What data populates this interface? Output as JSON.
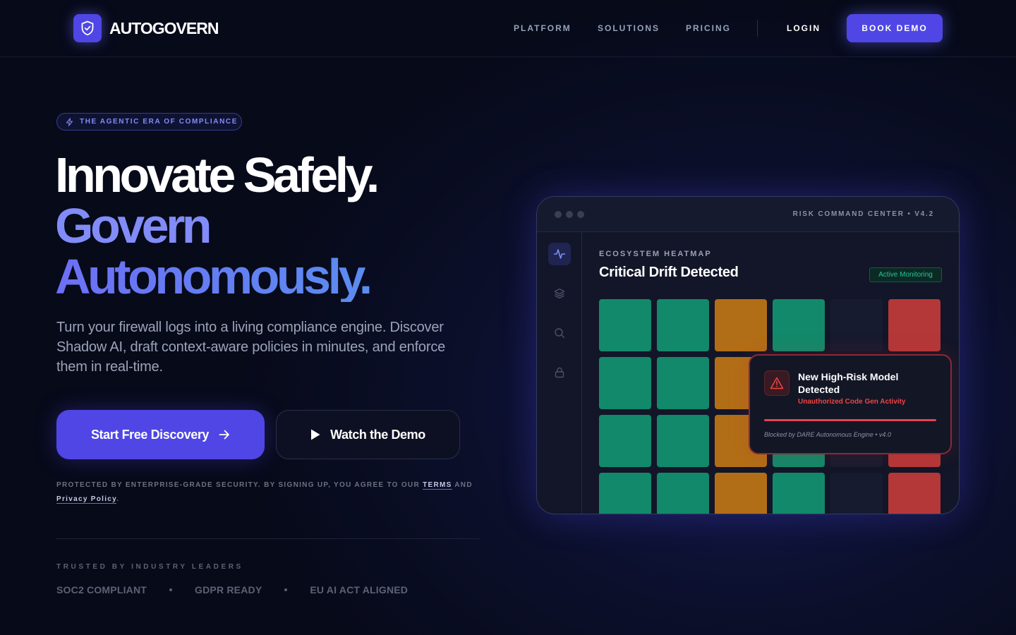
{
  "brand": {
    "name": "AUTOGOVERN",
    "logo_icon": "shield-check-icon",
    "accent": "#4f46e5"
  },
  "nav": {
    "links": [
      "PLATFORM",
      "SOLUTIONS",
      "PRICING"
    ],
    "login": "LOGIN",
    "cta": "BOOK DEMO"
  },
  "hero": {
    "eyebrow": "THE AGENTIC ERA OF COMPLIANCE",
    "eyebrow_icon": "lightning-icon",
    "headline_1": "Innovate Safely.",
    "headline_2": "Govern",
    "headline_3": "Autonomously.",
    "subtext": "Turn your firewall logs into a living compliance engine. Discover Shadow AI, draft context-aware policies in minutes, and enforce them in real-time.",
    "primary_cta": "Start Free Discovery",
    "secondary_cta": "Watch the Demo",
    "legal_prefix": "PROTECTED BY ENTERPRISE-GRADE SECURITY. BY SIGNING UP, YOU AGREE TO OUR",
    "legal_terms": "TERMS",
    "legal_and": "AND",
    "legal_privacy": "Privacy Policy",
    "legal_end": ".",
    "trusted_label": "TRUSTED BY INDUSTRY LEADERS",
    "badges": [
      "SOC2 COMPLIANT",
      "GDPR READY",
      "EU AI ACT ALIGNED"
    ]
  },
  "dashboard": {
    "title": "RISK COMMAND CENTER • V4.2",
    "rail_icons": [
      "activity-icon",
      "layers-icon",
      "search-icon",
      "lock-icon"
    ],
    "section_label": "ECOSYSTEM HEATMAP",
    "section_title": "Critical Drift Detected",
    "status": "Active Monitoring",
    "heatmap": [
      [
        "green",
        "green",
        "amber",
        "green",
        "dim",
        "red"
      ],
      [
        "green",
        "green",
        "amber",
        "green",
        "dim",
        "red"
      ],
      [
        "green",
        "green",
        "amber",
        "green",
        "dim",
        "red"
      ],
      [
        "green",
        "green",
        "amber",
        "green",
        "dim",
        "red"
      ]
    ],
    "colors": {
      "green": "#12896a",
      "amber": "#b26e16",
      "red": "#b43838"
    },
    "alert": {
      "icon": "warning-triangle-icon",
      "title": "New High-Risk Model Detected",
      "subtitle": "Unauthorized Code Gen Activity",
      "footer": "Blocked by DARE Autonomous Engine • v4.0"
    }
  }
}
